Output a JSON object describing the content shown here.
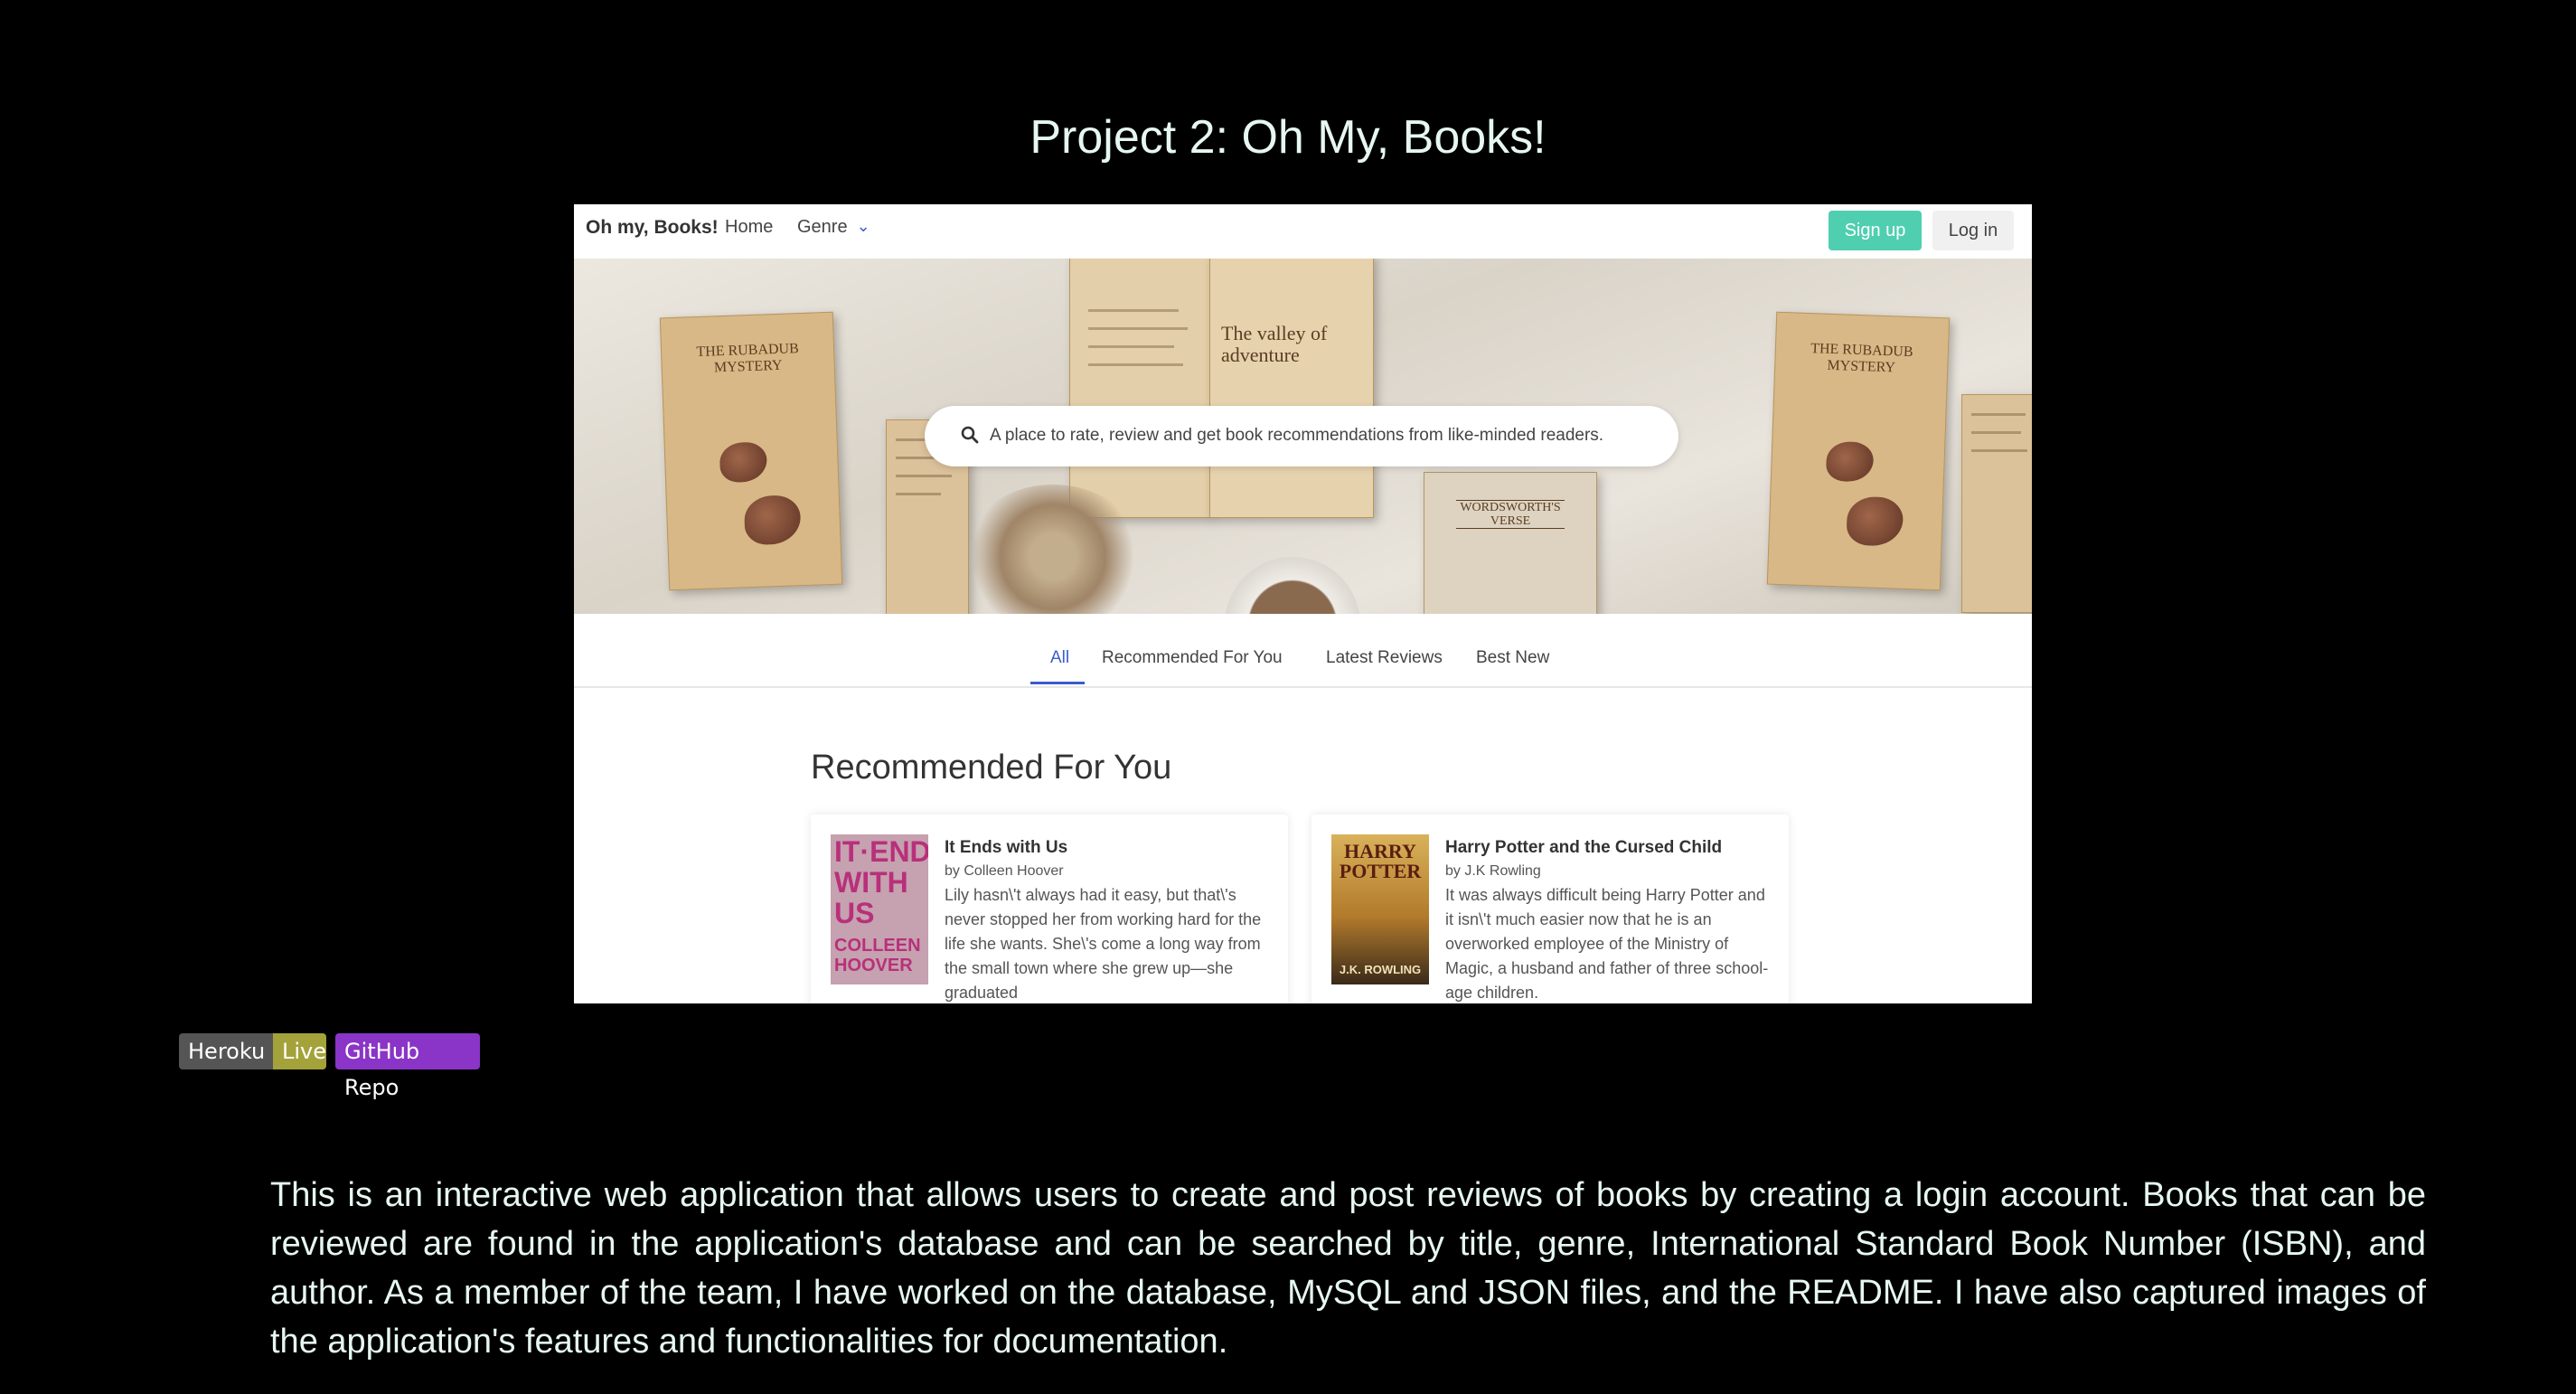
{
  "project_title": "Project 2: Oh My, Books!",
  "screenshot": {
    "nav": {
      "brand": "Oh my, Books!",
      "home": "Home",
      "genre": "Genre",
      "signup": "Sign up",
      "login": "Log in"
    },
    "hero": {
      "search_text": "A place to rate, review and get book recommendations from like-minded readers.",
      "book_left_title": "THE RUBADUB MYSTERY",
      "book_center_title": "The valley of adventure",
      "book_right_title": "THE RUBADUB MYSTERY",
      "book_verse_title": "WORDSWORTH'S VERSE"
    },
    "tabs": [
      "All",
      "Recommended For You",
      "Latest Reviews",
      "Best New"
    ],
    "active_tab": "All",
    "section_title": "Recommended For You",
    "cards": [
      {
        "title": "It Ends with Us",
        "author": "by Colleen Hoover",
        "description": "Lily hasn\\'t always had it easy, but that\\'s never stopped her from working hard for the life she wants. She\\'s come a long way from the small town where she grew up—she graduated",
        "cover_lines": [
          "IT·ENDS",
          "WITH",
          "US"
        ],
        "cover_author": "COLLEEN HOOVER"
      },
      {
        "title": "Harry Potter and the Cursed Child",
        "author": "by J.K Rowling",
        "description": "It was always difficult being Harry Potter and it isn\\'t much easier now that he is an overworked employee of the Ministry of Magic, a husband and father of three school-age children.",
        "cover_lines": [
          "HARRY",
          "POTTER"
        ],
        "cover_author": "J.K. ROWLING"
      }
    ]
  },
  "badges": {
    "heroku_left": "Heroku",
    "heroku_right": "Live",
    "github": "GitHub Repo"
  },
  "description": "This is an interactive web application that allows users to create and post reviews of books by creating a login account. Books that can be reviewed are found in the application's database and can be searched by title, genre, International Standard Book Number (ISBN), and author. As a member of the team, I have worked on the database, MySQL and JSON files, and the README. I have also captured images of the application's features and functionalities for documentation.",
  "colors": {
    "background": "#000000",
    "accent_green": "#4fcfb0",
    "tab_blue": "#3a5ccc",
    "badge_purple": "#8a35c7",
    "badge_olive": "#a4a23a"
  }
}
